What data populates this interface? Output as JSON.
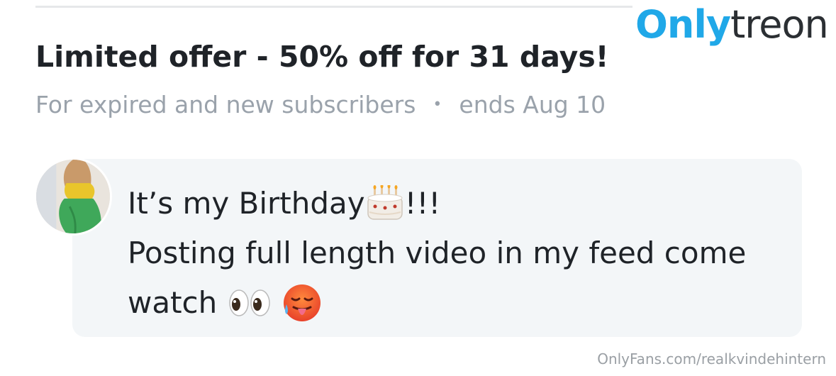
{
  "watermark_logo": {
    "part1": "Only",
    "part2": "treon"
  },
  "offer": {
    "title": "Limited offer - 50% off for 31 days!",
    "audience": "For expired and new subscribers",
    "separator": "•",
    "ends": "ends Aug 10"
  },
  "message": {
    "line1_text": "It’s my Birthday",
    "line1_suffix": "!!!",
    "line2": "Posting full length video in my feed come",
    "line3": "watch",
    "emojis": [
      "birthday-cake",
      "eyes",
      "hot-face"
    ]
  },
  "footer": {
    "source": "OnlyFans.com/realkvindehintern"
  },
  "colors": {
    "logo_blue": "#20a8e8",
    "muted": "#9aa2ab",
    "bubble": "#f3f6f8"
  }
}
